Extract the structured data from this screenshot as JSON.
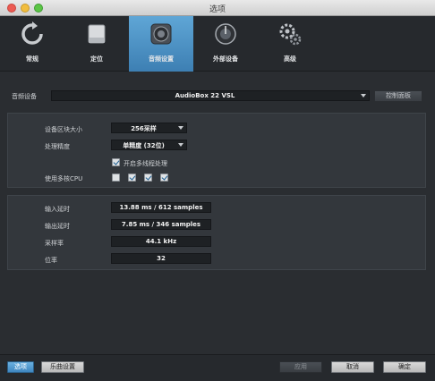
{
  "window": {
    "title": "选项"
  },
  "tabs": [
    {
      "label": "常规",
      "icon": "refresh-icon",
      "active": false
    },
    {
      "label": "定位",
      "icon": "drive-icon",
      "active": false
    },
    {
      "label": "音频设置",
      "icon": "speaker-icon",
      "active": true
    },
    {
      "label": "外部设备",
      "icon": "knob-icon",
      "active": false
    },
    {
      "label": "高级",
      "icon": "gears-icon",
      "active": false
    }
  ],
  "audio_device": {
    "label": "音频设备",
    "value": "AudioBox 22 VSL",
    "control_panel_button": "控制面板"
  },
  "settings": {
    "buffer_size_label": "设备区块大小",
    "buffer_size_value": "256采样",
    "precision_label": "处理精度",
    "precision_value": "单精度 (32位)",
    "multithread_label": "开启多线程处理",
    "multithread_checked": true,
    "multicore_label": "使用多核CPU",
    "multicore_checks": [
      false,
      true,
      true,
      true
    ]
  },
  "info": {
    "input_latency_label": "输入延时",
    "input_latency_value": "13.88 ms / 612 samples",
    "output_latency_label": "输出延时",
    "output_latency_value": "7.85 ms / 346 samples",
    "sample_rate_label": "采样率",
    "sample_rate_value": "44.1 kHz",
    "bit_depth_label": "位率",
    "bit_depth_value": "32"
  },
  "footer": {
    "options_button": "选项",
    "song_settings_button": "乐曲设置",
    "apply_button": "应用",
    "cancel_button": "取消",
    "ok_button": "确定"
  },
  "colors": {
    "accent": "#4d94c8",
    "background": "#2a2d31",
    "panel": "#33373c"
  }
}
